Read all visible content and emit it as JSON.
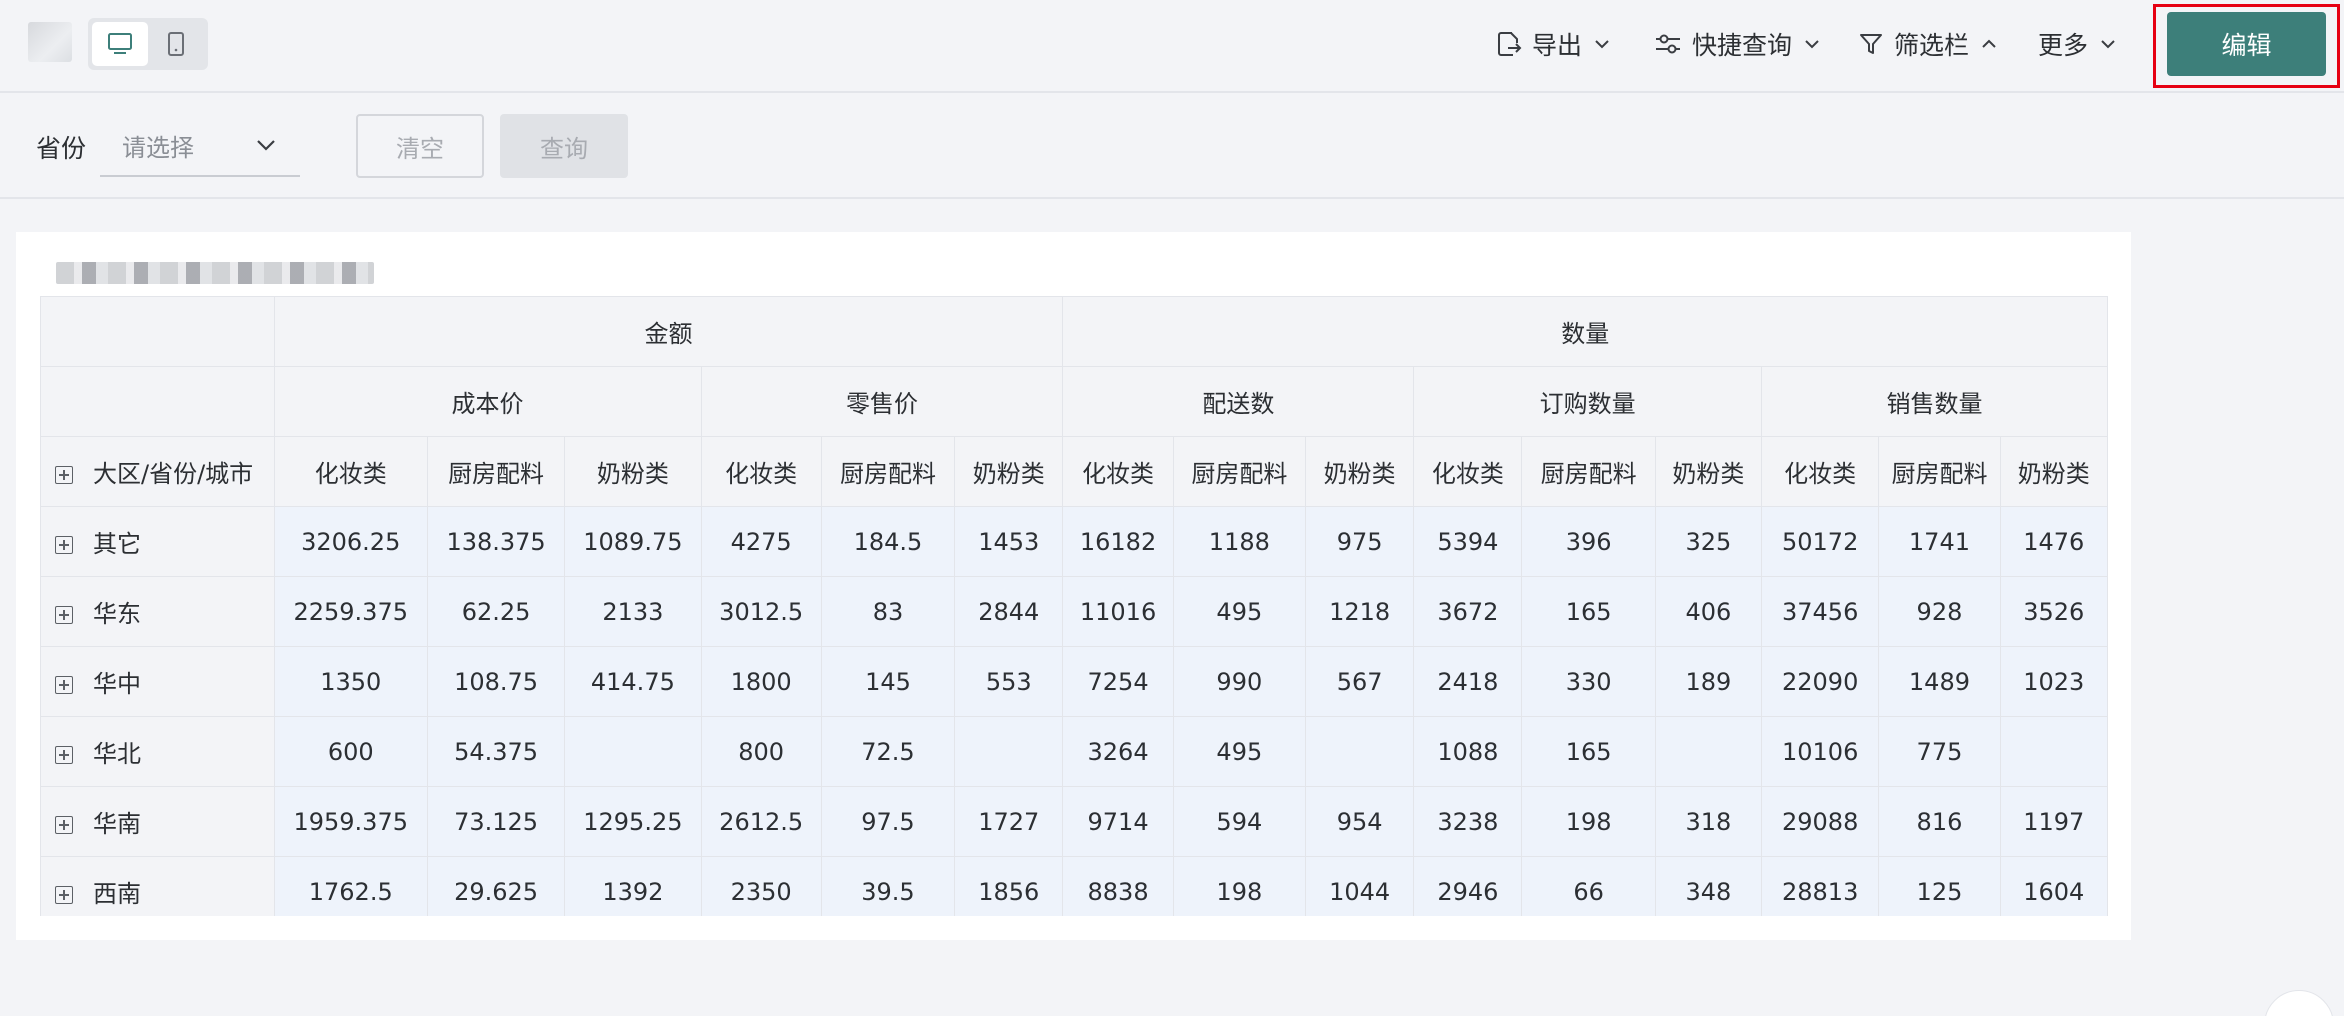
{
  "toolbar": {
    "export_label": "导出",
    "quick_query_label": "快捷查询",
    "filter_bar_label": "筛选栏",
    "more_label": "更多",
    "edit_label": "编辑"
  },
  "filter": {
    "province_label": "省份",
    "province_placeholder": "请选择",
    "clear_label": "清空",
    "query_label": "查询"
  },
  "colors": {
    "accent": "#3d7f7a",
    "highlight_border": "#e60012",
    "cell_bg": "#eef3fb"
  },
  "table": {
    "group_headers": [
      {
        "label": "金额",
        "span": 6
      },
      {
        "label": "数量",
        "span": 9
      }
    ],
    "sub_headers": [
      {
        "label": "成本价",
        "span": 3
      },
      {
        "label": "零售价",
        "span": 3
      },
      {
        "label": "配送数",
        "span": 3
      },
      {
        "label": "订购数量",
        "span": 3
      },
      {
        "label": "销售数量",
        "span": 3
      }
    ],
    "row_header_label": "大区/省份/城市",
    "leaf_headers": [
      "化妆类",
      "厨房配料",
      "奶粉类",
      "化妆类",
      "厨房配料",
      "奶粉类",
      "化妆类",
      "厨房配料",
      "奶粉类",
      "化妆类",
      "厨房配料",
      "奶粉类",
      "化妆类",
      "厨房配料",
      "奶粉类"
    ],
    "rows": [
      {
        "region": "其它",
        "values": [
          "3206.25",
          "138.375",
          "1089.75",
          "4275",
          "184.5",
          "1453",
          "16182",
          "1188",
          "975",
          "5394",
          "396",
          "325",
          "50172",
          "1741",
          "1476"
        ]
      },
      {
        "region": "华东",
        "values": [
          "2259.375",
          "62.25",
          "2133",
          "3012.5",
          "83",
          "2844",
          "11016",
          "495",
          "1218",
          "3672",
          "165",
          "406",
          "37456",
          "928",
          "3526"
        ]
      },
      {
        "region": "华中",
        "values": [
          "1350",
          "108.75",
          "414.75",
          "1800",
          "145",
          "553",
          "7254",
          "990",
          "567",
          "2418",
          "330",
          "189",
          "22090",
          "1489",
          "1023"
        ]
      },
      {
        "region": "华北",
        "values": [
          "600",
          "54.375",
          "",
          "800",
          "72.5",
          "",
          "3264",
          "495",
          "",
          "1088",
          "165",
          "",
          "10106",
          "775",
          ""
        ]
      },
      {
        "region": "华南",
        "values": [
          "1959.375",
          "73.125",
          "1295.25",
          "2612.5",
          "97.5",
          "1727",
          "9714",
          "594",
          "954",
          "3238",
          "198",
          "318",
          "29088",
          "816",
          "1197"
        ]
      },
      {
        "region": "西南",
        "values": [
          "1762.5",
          "29.625",
          "1392",
          "2350",
          "39.5",
          "1856",
          "8838",
          "198",
          "1044",
          "2946",
          "66",
          "348",
          "28813",
          "125",
          "1604"
        ]
      }
    ]
  }
}
